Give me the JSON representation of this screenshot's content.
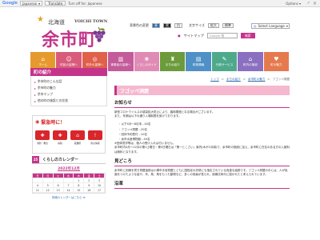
{
  "gbar": {
    "logo": "Google",
    "from_lang": "Japanese",
    "translate_label": "Translate",
    "to_lang": "Turn off for: Japanese",
    "options_label": "Options ▾"
  },
  "header": {
    "logo_prefix": "北海道",
    "logo_en": "YOICHI TOWN",
    "logo_main": "余市町",
    "links": [
      "背景色の変更",
      "青",
      "黒",
      "白"
    ],
    "text_size_label": "文字サイズ",
    "text_size_btns": [
      "拡大",
      "標準"
    ],
    "lang_select": "Select Language",
    "sitemap_label": "サイトマップ",
    "search_placeholder": "Google 検",
    "search_button": "検索"
  },
  "nav": [
    {
      "label": "ホーム",
      "icon": "home-icon",
      "glyph": "⌂",
      "color": "#e69a2e"
    },
    {
      "label": "町民の皆様へ",
      "icon": "people-icon",
      "glyph": "☺",
      "color": "#d95b7c"
    },
    {
      "label": "町外の皆様へ",
      "icon": "globe-icon",
      "glyph": "◎",
      "color": "#e0604a"
    },
    {
      "label": "事業者の皆様へ",
      "icon": "building-icon",
      "glyph": "▥",
      "color": "#c45b9a"
    },
    {
      "label": "くらしのガイド",
      "icon": "guide-icon",
      "glyph": "❀",
      "color": "#e08bb5"
    },
    {
      "label": "まちの紹介",
      "icon": "town-icon",
      "glyph": "♜",
      "color": "#6b9b3a"
    },
    {
      "label": "町政情報",
      "icon": "office-icon",
      "glyph": "▤",
      "color": "#4f90c6"
    },
    {
      "label": "行政サービス",
      "icon": "service-icon",
      "glyph": "✎",
      "color": "#4ea98b"
    },
    {
      "label": "町内の施設",
      "icon": "facility-icon",
      "glyph": "⌂",
      "color": "#8b6fc0"
    },
    {
      "label": "町の魅力",
      "icon": "heart-icon",
      "glyph": "♥",
      "color": "#e57a4f"
    }
  ],
  "breadcrumb": [
    "トップ",
    "まちの紹介",
    "余市町の魅力",
    "フゴッペ洞窟"
  ],
  "page_title": "フゴッペ洞窟",
  "side": {
    "heading": "町の紹介",
    "items": [
      "余市町のこんな話",
      "余市町の魅力",
      "余市マップ",
      "他の町の施設との交流"
    ]
  },
  "emergency": {
    "heading": "緊急時に！",
    "items": [
      {
        "label": "消防・救急",
        "icon": "fire-icon",
        "glyph": "✚",
        "color": "#d9262b"
      },
      {
        "label": "病院",
        "icon": "hospital-icon",
        "glyph": "✚",
        "color": "#d9262b"
      },
      {
        "label": "避難所",
        "icon": "shelter-icon",
        "glyph": "⌂",
        "color": "#d9262b"
      },
      {
        "label": "防災情報",
        "icon": "alert-icon",
        "glyph": "!",
        "color": "#d9262b"
      }
    ]
  },
  "calendar": {
    "number": "25",
    "heading": "くらしのカレンダー",
    "month": "2022年12月",
    "weekdays": [
      "日",
      "月",
      "火",
      "水",
      "木",
      "金",
      "土"
    ],
    "days": [
      "",
      "",
      "",
      "",
      "1",
      "2",
      "3",
      "4",
      "5",
      "6",
      "7",
      "8",
      "9",
      "10",
      "11",
      "12",
      "13",
      "14",
      "15",
      "16",
      "17"
    ],
    "footer": "詳細カレンダーはこちら ≫"
  },
  "main": {
    "notice_heading": "お知らせ",
    "notice_text": "新型コロナウイルスの感染拡大防止により、臨時閉館となる場合がございます。",
    "notice_text2": "また、冬期は以下の通り入場制限を設けております。",
    "list": [
      "以下4月～8月末…40名",
      "フゴッペ洞窟…20名",
      "団体予約受付…10名",
      "余市水産博物館…40名"
    ],
    "notice_foot": "※団体見学等は、個人の受け入れは行いません。",
    "notice_foot2": "余市町内4月～12月の第1土曜日・第3日曜日は「第一とこさい」案内(木が1月頃)で、余市町の施設に加え、余市町に在住のある方の入館料は無料となります。",
    "sec2_heading": "見どころ",
    "sec2_text": "余市町に刻線を残す洞窟遺跡は小樽市手宮洞窟とともに国指定の史跡にも指定されている貴重な遺跡です。フゴッペ洞窟の中には、人が仮面をつけたような姿や、舟、鳥、角をもった動物など、多くの刻画が見られ、続縄文時代に描かれたと考えられています。",
    "sec3_heading": "沿革"
  }
}
